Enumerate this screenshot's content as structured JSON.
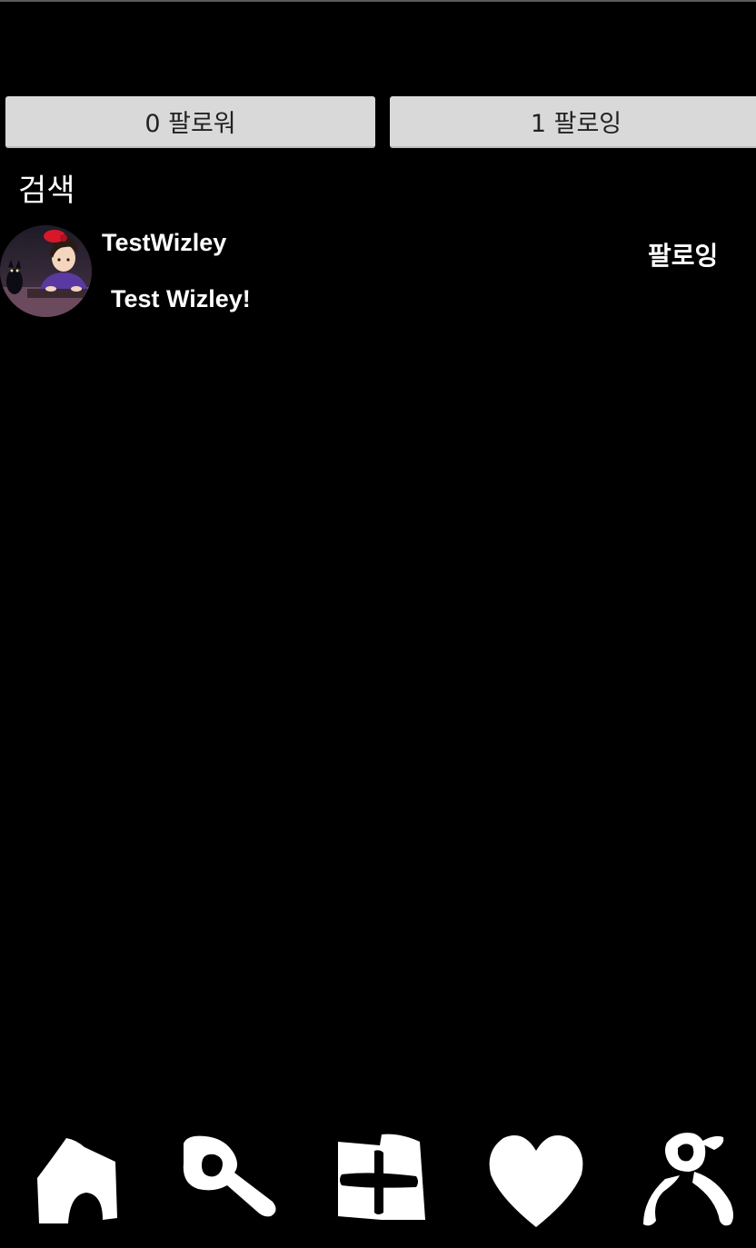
{
  "tabs": {
    "followers": "0 팔로워",
    "following": "1 팔로잉"
  },
  "search": {
    "label": "검색"
  },
  "users": [
    {
      "username": "TestWizley",
      "bio": "Test Wizley!",
      "follow_state": "팔로잉"
    }
  ],
  "nav": {
    "items": [
      {
        "icon": "home-icon"
      },
      {
        "icon": "search-icon"
      },
      {
        "icon": "add-icon"
      },
      {
        "icon": "heart-icon"
      },
      {
        "icon": "profile-icon"
      }
    ]
  },
  "colors": {
    "background": "#000000",
    "tab_background": "#d8d9d8",
    "text": "#ffffff"
  }
}
